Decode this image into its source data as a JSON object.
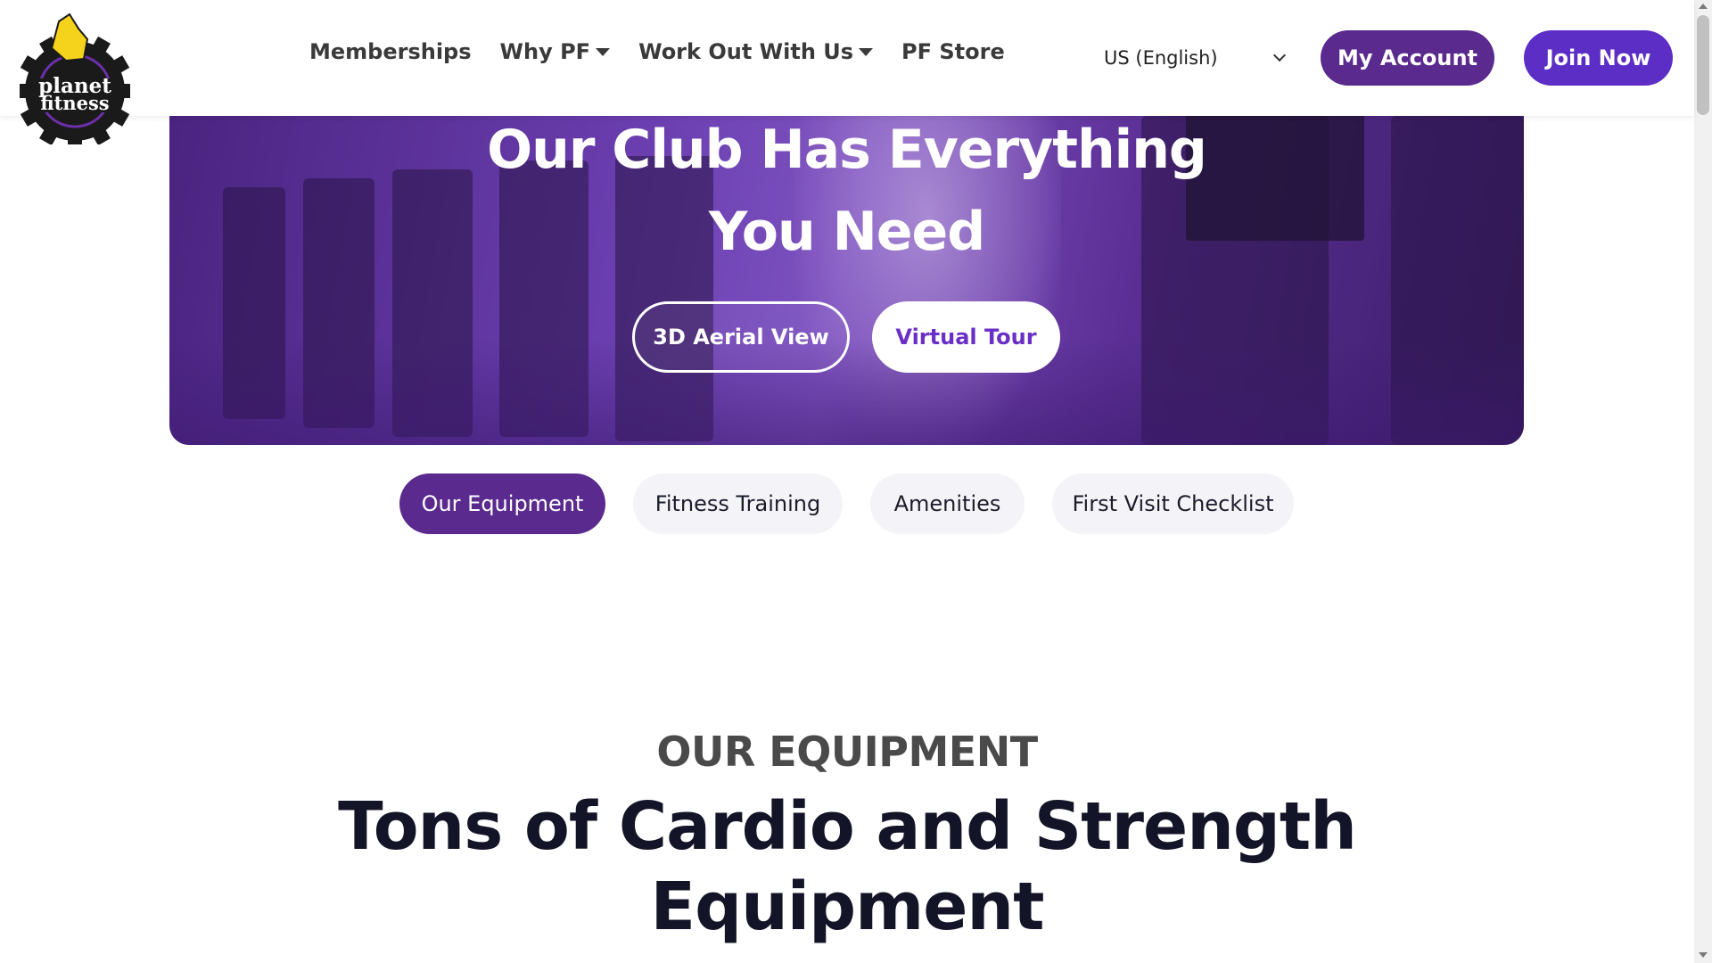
{
  "brand": {
    "logo_line1": "planet",
    "logo_line2": "fitness",
    "accent": "#5a2a8e",
    "join_color": "#5c2ec5"
  },
  "nav": {
    "items": [
      {
        "label": "Memberships",
        "has_dropdown": false
      },
      {
        "label": "Why PF",
        "has_dropdown": true
      },
      {
        "label": "Work Out With Us",
        "has_dropdown": true
      },
      {
        "label": "PF Store",
        "has_dropdown": false
      }
    ],
    "language": "US (English)",
    "my_account": "My Account",
    "join_now": "Join Now"
  },
  "hero": {
    "title_line1": "Our Club Has Everything",
    "title_line2": "You Need",
    "aerial_label": "3D Aerial View",
    "tour_label": "Virtual Tour"
  },
  "tabs": [
    {
      "label": "Our Equipment",
      "active": true
    },
    {
      "label": "Fitness Training",
      "active": false
    },
    {
      "label": "Amenities",
      "active": false
    },
    {
      "label": "First Visit Checklist",
      "active": false
    }
  ],
  "section": {
    "eyebrow": "OUR EQUIPMENT",
    "title_line1": "Tons of Cardio and Strength",
    "title_line2": "Equipment"
  }
}
